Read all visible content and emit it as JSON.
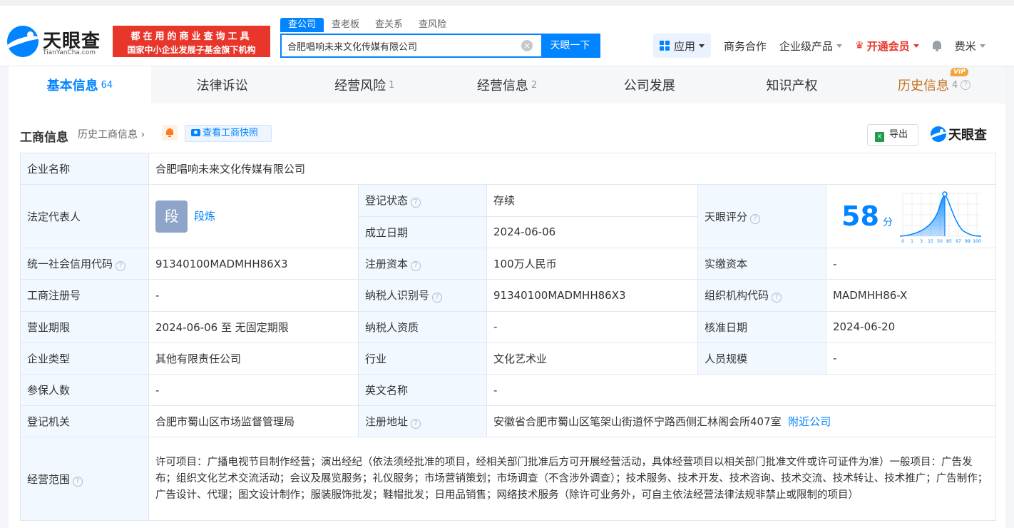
{
  "header": {
    "logo_name": "天眼查",
    "logo_url": "TianYanCha.com",
    "slogan_line1": "都在用的商业查询工具",
    "slogan_line2": "国家中小企业发展子基金旗下机构",
    "search_tabs": [
      "查公司",
      "查老板",
      "查关系",
      "查风险"
    ],
    "search_value": "合肥唱响未来文化传媒有限公司",
    "search_button": "天眼一下",
    "nav": {
      "app": "应用",
      "business": "商务合作",
      "enterprise": "企业级产品",
      "vip": "开通会员",
      "user": "费米"
    }
  },
  "tabs": [
    {
      "label": "基本信息",
      "count": "64"
    },
    {
      "label": "法律诉讼",
      "count": ""
    },
    {
      "label": "经营风险",
      "count": "1"
    },
    {
      "label": "经营信息",
      "count": "2"
    },
    {
      "label": "公司发展",
      "count": ""
    },
    {
      "label": "知识产权",
      "count": ""
    },
    {
      "label": "历史信息",
      "count": "4",
      "tag": "VIP"
    }
  ],
  "section": {
    "title": "工商信息",
    "history_link": "历史工商信息",
    "snapshot_button": "查看工商快照",
    "export_button": "导出",
    "brand": "天眼查"
  },
  "info": {
    "company_name_label": "企业名称",
    "company_name": "合肥唱响未来文化传媒有限公司",
    "legal_rep_label": "法定代表人",
    "legal_rep_avatar": "段",
    "legal_rep": "段炼",
    "reg_status_label": "登记状态",
    "reg_status": "存续",
    "est_date_label": "成立日期",
    "est_date": "2024-06-06",
    "score_label": "天眼评分",
    "score": "58",
    "score_unit": "分",
    "score_ticks": [
      "0",
      "1",
      "3",
      "15",
      "50",
      "85",
      "97",
      "99",
      "100"
    ],
    "credit_code_label": "统一社会信用代码",
    "credit_code": "91340100MADMHH86X3",
    "reg_capital_label": "注册资本",
    "reg_capital": "100万人民币",
    "paid_capital_label": "实缴资本",
    "paid_capital": "-",
    "reg_no_label": "工商注册号",
    "reg_no": "-",
    "taxpayer_id_label": "纳税人识别号",
    "taxpayer_id": "91340100MADMHH86X3",
    "org_code_label": "组织机构代码",
    "org_code": "MADMHH86-X",
    "term_label": "营业期限",
    "term": "2024-06-06 至 无固定期限",
    "taxpayer_qual_label": "纳税人资质",
    "taxpayer_qual": "-",
    "approval_date_label": "核准日期",
    "approval_date": "2024-06-20",
    "company_type_label": "企业类型",
    "company_type": "其他有限责任公司",
    "industry_label": "行业",
    "industry": "文化艺术业",
    "staff_size_label": "人员规模",
    "staff_size": "-",
    "insured_label": "参保人数",
    "insured": "-",
    "english_name_label": "英文名称",
    "english_name": "-",
    "authority_label": "登记机关",
    "authority": "合肥市蜀山区市场监督管理局",
    "address_label": "注册地址",
    "address": "安徽省合肥市蜀山区笔架山街道怀宁路西侧汇林阁会所407室",
    "nearby_link": "附近公司",
    "scope_label": "经营范围",
    "scope": "许可项目：广播电视节目制作经营；演出经纪（依法须经批准的项目，经相关部门批准后方可开展经营活动，具体经营项目以相关部门批准文件或许可证件为准）一般项目：广告发布；组织文化艺术交流活动；会议及展览服务；礼仪服务；市场营销策划；市场调查（不含涉外调查）；技术服务、技术开发、技术咨询、技术交流、技术转让、技术推广；广告制作；广告设计、代理；图文设计制作；服装服饰批发；鞋帽批发；日用品销售；网络技术服务（除许可业务外，可自主依法经营法律法规非禁止或限制的项目）"
  },
  "colors": {
    "brand_blue": "#0084ff",
    "slogan_red": "#e8362b",
    "status_green": "#2aa05a",
    "history_orange": "#c5711c",
    "label_bg": "#f2f8ff"
  }
}
